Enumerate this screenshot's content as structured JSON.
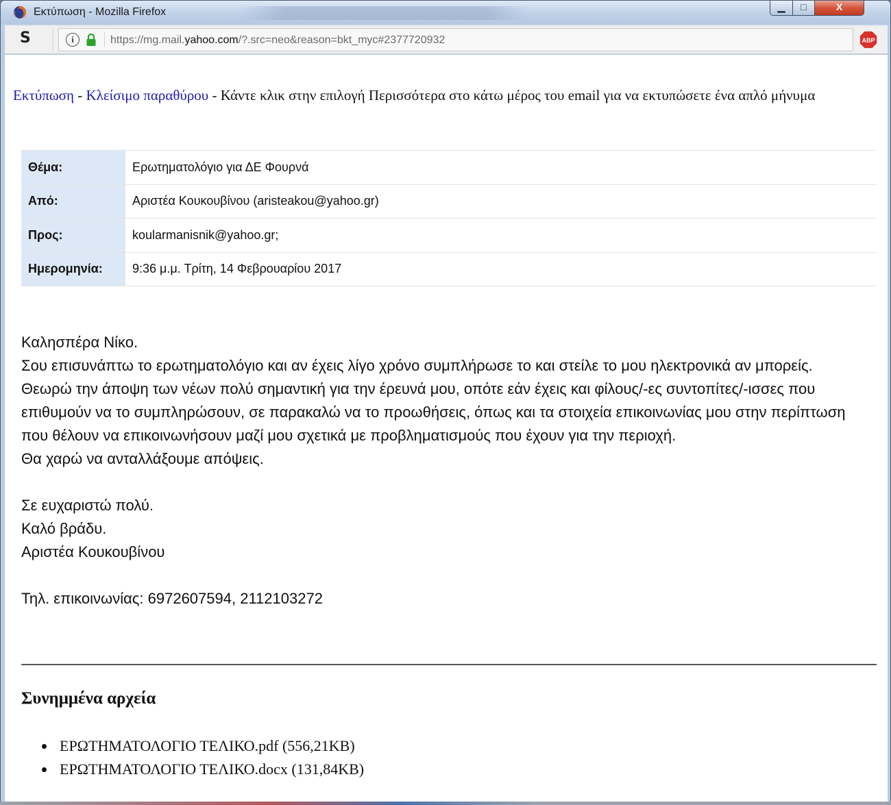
{
  "window": {
    "title": "Εκτύπωση - Mozilla Firefox",
    "min_glyph": "▁",
    "max_glyph": "□",
    "close_glyph": "X"
  },
  "address_bar": {
    "s_glyph": "S",
    "info_glyph": "i",
    "url_prefix": "https://mg.mail.",
    "url_domain": "yahoo.com",
    "url_rest": "/?.src=neo&reason=bkt_myc#2377720932",
    "abp_label": "ABP"
  },
  "toolbar": {
    "print_link": "Εκτύπωση",
    "dash1": " - ",
    "close_link": "Κλείσιμο παραθύρου",
    "hint": " - Κάντε κλικ στην επιλογή Περισσότερα στο κάτω μέρος του email για να εκτυπώσετε ένα απλό μήνυμα"
  },
  "headers": [
    {
      "label": "Θέμα:",
      "value": "Ερωτηματολόγιο για ΔΕ Φουρνά"
    },
    {
      "label": "Από:",
      "value": "Αριστέα Κουκουβίνου (aristeakou@yahoo.gr)"
    },
    {
      "label": "Προς:",
      "value": "koularmanisnik@yahoo.gr;"
    },
    {
      "label": "Ημερομηνία:",
      "value": "9:36 μ.μ. Τρίτη, 14 Φεβρουαρίου 2017"
    }
  ],
  "message": {
    "greeting": "Καλησπέρα Νίκο.",
    "p1": "Σου επισυνάπτω το ερωτηματολόγιο και αν έχεις λίγο χρόνο συμπλήρωσε το και στείλε το μου ηλεκτρονικά αν μπορείς.",
    "p2": "Θεωρώ την άποψη των νέων πολύ σημαντική για την έρευνά μου, οπότε εάν έχεις και φίλους/-ες συντοπίτες/-ισσες που επιθυμούν να το συμπληρώσουν, σε παρακαλώ να το προωθήσεις, όπως και τα στοιχεία επικοινωνίας μου στην περίπτωση που θέλουν να επικοινωνήσουν μαζί μου σχετικά με προβληματισμούς που έχουν για την περιοχή.",
    "p3": "Θα χαρώ να ανταλλάξουμε απόψεις.",
    "thanks": "Σε ευχαριστώ πολύ.",
    "goodnight": "Καλό βράδυ.",
    "signature": "Αριστέα Κουκουβίνου",
    "phone": "Τηλ. επικοινωνίας: 6972607594, 2112103272"
  },
  "attachments": {
    "title": "Συνημμένα αρχεία",
    "items": [
      "ΕΡΩΤΗΜΑΤΟΛΟΓΙΟ ΤΕΛΙΚΟ.pdf (556,21KB)",
      "ΕΡΩΤΗΜΑΤΟΛΟΓΙΟ ΤΕΛΙΚΟ.docx (131,84KB)"
    ]
  },
  "colors": {
    "link": "#1b1bb0",
    "label_bg": "#dde8f6",
    "close_button": "#c94a30"
  }
}
